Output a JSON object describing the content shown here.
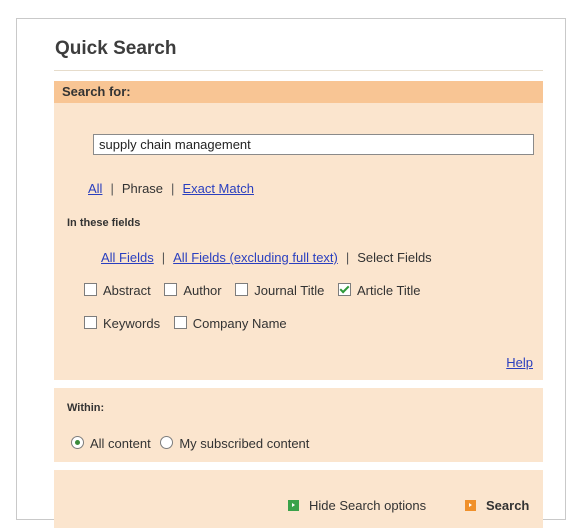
{
  "page": {
    "title": "Quick Search"
  },
  "search": {
    "section_label": "Search for:",
    "query_value": "supply chain management",
    "match_modes": [
      {
        "label": "All",
        "link": true
      },
      {
        "label": "Phrase",
        "link": false
      },
      {
        "label": "Exact Match",
        "link": true
      }
    ]
  },
  "fields": {
    "section_label": "In these fields",
    "scopes": [
      {
        "label": "All Fields",
        "link": true
      },
      {
        "label": "All Fields (excluding full text)",
        "link": true
      },
      {
        "label": "Select Fields",
        "link": false
      }
    ],
    "checkboxes": [
      {
        "label": "Abstract",
        "checked": false
      },
      {
        "label": "Author",
        "checked": false
      },
      {
        "label": "Journal Title",
        "checked": false
      },
      {
        "label": "Article Title",
        "checked": true
      },
      {
        "label": "Keywords",
        "checked": false
      },
      {
        "label": "Company Name",
        "checked": false
      }
    ],
    "help_label": "Help"
  },
  "within": {
    "section_label": "Within:",
    "options": [
      {
        "label": "All content",
        "selected": true
      },
      {
        "label": "My subscribed content",
        "selected": false
      }
    ]
  },
  "actions": {
    "hide_options_label": "Hide Search options",
    "search_label": "Search"
  },
  "colors": {
    "header_bg": "#f8c594",
    "panel_bg": "#fbe5ce",
    "link": "#2a3fbf",
    "green_icon": "#3aa24a",
    "orange_icon": "#f0902a"
  }
}
